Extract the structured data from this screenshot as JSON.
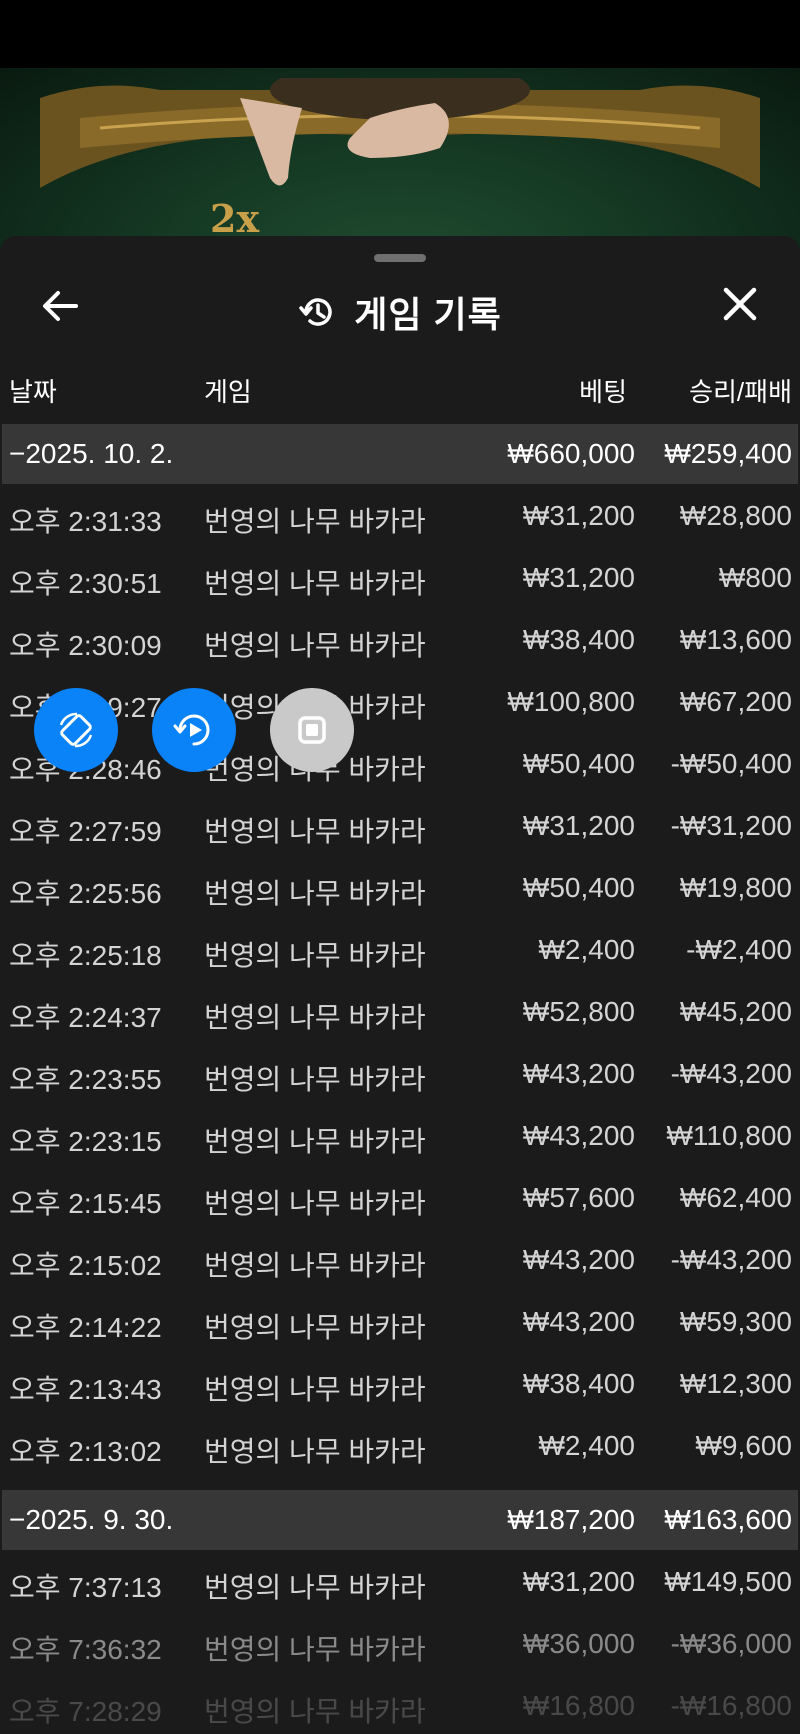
{
  "video": {
    "multiplier": "2x"
  },
  "header": {
    "title": "게임 기록",
    "icons": {
      "back": "arrow-left-icon",
      "history": "history-icon",
      "close": "close-icon"
    }
  },
  "columns": {
    "date": "날짜",
    "game": "게임",
    "bet": "베팅",
    "result": "승리/패배"
  },
  "groups": [
    {
      "date": "−2025. 10. 2.",
      "total_bet": "₩660,000",
      "total_result": "₩259,400",
      "rows": [
        {
          "time": "오후 2:31:33",
          "game": "번영의 나무 바카라",
          "bet": "₩31,200",
          "result": "₩28,800"
        },
        {
          "time": "오후 2:30:51",
          "game": "번영의 나무 바카라",
          "bet": "₩31,200",
          "result": "₩800"
        },
        {
          "time": "오후 2:30:09",
          "game": "번영의 나무 바카라",
          "bet": "₩38,400",
          "result": "₩13,600"
        },
        {
          "time": "오후 2:29:27",
          "game": "번영의 나무 바카라",
          "bet": "₩100,800",
          "result": "₩67,200"
        },
        {
          "time": "오후 2:28:46",
          "game": "번영의 나무 바카라",
          "bet": "₩50,400",
          "result": "-₩50,400"
        },
        {
          "time": "오후 2:27:59",
          "game": "번영의 나무 바카라",
          "bet": "₩31,200",
          "result": "-₩31,200"
        },
        {
          "time": "오후 2:25:56",
          "game": "번영의 나무 바카라",
          "bet": "₩50,400",
          "result": "₩19,800"
        },
        {
          "time": "오후 2:25:18",
          "game": "번영의 나무 바카라",
          "bet": "₩2,400",
          "result": "-₩2,400"
        },
        {
          "time": "오후 2:24:37",
          "game": "번영의 나무 바카라",
          "bet": "₩52,800",
          "result": "₩45,200"
        },
        {
          "time": "오후 2:23:55",
          "game": "번영의 나무 바카라",
          "bet": "₩43,200",
          "result": "-₩43,200"
        },
        {
          "time": "오후 2:23:15",
          "game": "번영의 나무 바카라",
          "bet": "₩43,200",
          "result": "₩110,800"
        },
        {
          "time": "오후 2:15:45",
          "game": "번영의 나무 바카라",
          "bet": "₩57,600",
          "result": "₩62,400"
        },
        {
          "time": "오후 2:15:02",
          "game": "번영의 나무 바카라",
          "bet": "₩43,200",
          "result": "-₩43,200"
        },
        {
          "time": "오후 2:14:22",
          "game": "번영의 나무 바카라",
          "bet": "₩43,200",
          "result": "₩59,300"
        },
        {
          "time": "오후 2:13:43",
          "game": "번영의 나무 바카라",
          "bet": "₩38,400",
          "result": "₩12,300"
        },
        {
          "time": "오후 2:13:02",
          "game": "번영의 나무 바카라",
          "bet": "₩2,400",
          "result": "₩9,600"
        }
      ]
    },
    {
      "date": "−2025. 9. 30.",
      "total_bet": "₩187,200",
      "total_result": "₩163,600",
      "rows": [
        {
          "time": "오후 7:37:13",
          "game": "번영의 나무 바카라",
          "bet": "₩31,200",
          "result": "₩149,500"
        },
        {
          "time": "오후 7:36:32",
          "game": "번영의 나무 바카라",
          "bet": "₩36,000",
          "result": "-₩36,000"
        },
        {
          "time": "오후 7:28:29",
          "game": "번영의 나무 바카라",
          "bet": "₩16,800",
          "result": "-₩16,800"
        }
      ]
    }
  ],
  "floating_buttons": [
    {
      "icon": "rotate-screen-icon",
      "color": "#0a82f8"
    },
    {
      "icon": "replay-icon",
      "color": "#0a82f8"
    },
    {
      "icon": "stop-icon",
      "color": "#c9c9c9"
    }
  ]
}
